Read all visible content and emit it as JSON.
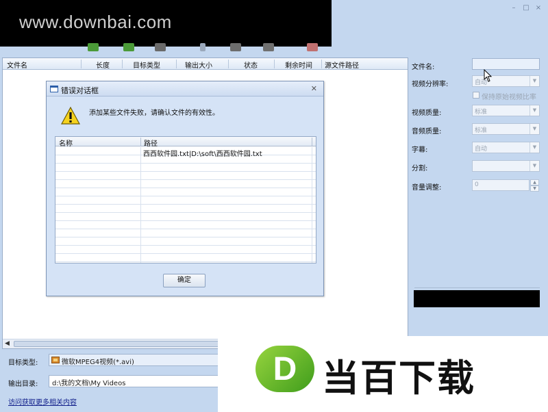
{
  "watermark_top": {
    "text": "www.downbai.com"
  },
  "window_controls": {
    "minimize": "–",
    "maximize": "□",
    "close": "×"
  },
  "file_list": {
    "columns": [
      "文件名",
      "长度",
      "目标类型",
      "输出大小",
      "状态",
      "剩余时间",
      "源文件路径"
    ]
  },
  "properties": {
    "filename_label": "文件名:",
    "resolution_label": "视频分辨率:",
    "resolution_value": "自动",
    "keep_ratio_label": "保持原始视频比率",
    "video_quality_label": "视频质量:",
    "video_quality_value": "标准",
    "audio_quality_label": "音频质量:",
    "audio_quality_value": "标准",
    "subtitle_label": "字幕:",
    "subtitle_value": "自动",
    "split_label": "分割:",
    "volume_label": "音量调整:",
    "volume_value": "0"
  },
  "bottom": {
    "target_type_label": "目标类型:",
    "target_type_value": "微软MPEG4视频(*.avi)",
    "output_dir_label": "输出目录:",
    "output_dir_value": "d:\\我的文档\\My Videos",
    "link": "访问获取更多相关内容"
  },
  "dialog": {
    "title": "错误对话框",
    "message": "添加某些文件失败，请确认文件的有效性。",
    "columns": [
      "名称",
      "路径"
    ],
    "rows": [
      {
        "name": "",
        "path": "西西软件园.txt|D:\\soft\\西西软件园.txt"
      }
    ],
    "ok_button": "确定"
  },
  "logo": {
    "letter": "D",
    "text": "当百下载"
  },
  "colors": {
    "window_bg": "#c4d7ef",
    "dialog_bg": "#d5e3f6",
    "logo_green": "#5cb22a",
    "link": "#13218c"
  }
}
